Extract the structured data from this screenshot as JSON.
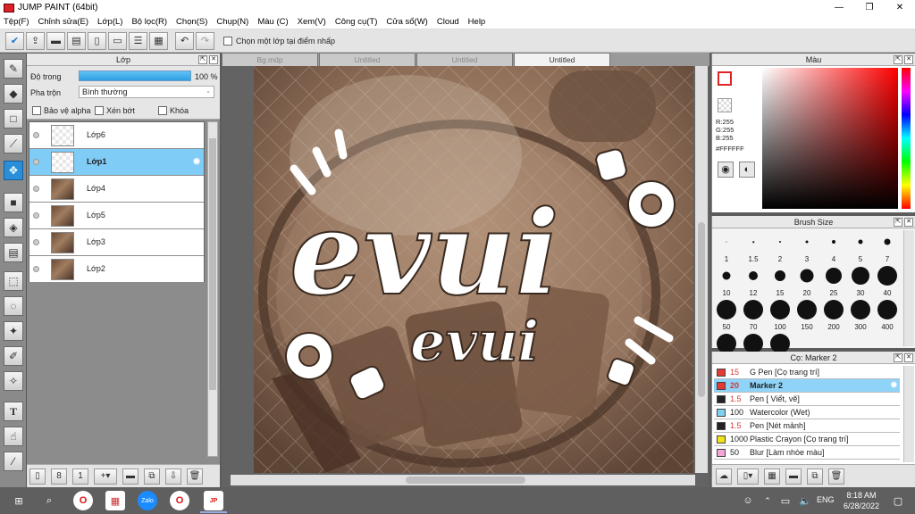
{
  "window": {
    "title": "JUMP PAINT (64bit)",
    "minimize": "—",
    "maximize": "❐",
    "close": "✕"
  },
  "menu": [
    "Tệp(F)",
    "Chỉnh sửa(E)",
    "Lớp(L)",
    "Bộ lọc(R)",
    "Chọn(S)",
    "Chụp(N)",
    "Màu (C)",
    "Xem(V)",
    "Công cụ(T)",
    "Cửa sổ(W)",
    "Cloud",
    "Help"
  ],
  "toolbar": {
    "snap_label": "Chọn một lớp tại điểm nhấp"
  },
  "layer_panel": {
    "title": "Lớp",
    "opacity_label": "Độ trong",
    "opacity_value": "100 %",
    "opacity_fraction": 1.0,
    "blend_label": "Pha trộn",
    "blend_value": "Bình thường",
    "protect_alpha": "Bảo vệ alpha",
    "clipping": "Xén bớt",
    "lock": "Khóa",
    "layers": [
      {
        "name": "Lớp6",
        "thumb": "empty",
        "selected": false
      },
      {
        "name": "Lớp1",
        "thumb": "empty",
        "selected": true
      },
      {
        "name": "Lớp4",
        "thumb": "photo",
        "selected": false
      },
      {
        "name": "Lớp5",
        "thumb": "photo",
        "selected": false
      },
      {
        "name": "Lớp3",
        "thumb": "photo",
        "selected": false
      },
      {
        "name": "Lớp2",
        "thumb": "photo",
        "selected": false
      }
    ]
  },
  "doc_tabs": [
    {
      "label": "Bg.mdp",
      "active": false
    },
    {
      "label": "Untitled",
      "active": false
    },
    {
      "label": "Untitled",
      "active": false
    },
    {
      "label": "Untitled",
      "active": true
    }
  ],
  "canvas": {
    "text_large": "evui",
    "text_small": "evui"
  },
  "color_panel": {
    "title": "Màu",
    "r": "R:255",
    "g": "G:255",
    "b": "B:255",
    "hex": "#FFFFFF"
  },
  "brush_panel": {
    "title": "Brush Size",
    "sizes": [
      "1",
      "1.5",
      "2",
      "3",
      "4",
      "5",
      "7",
      "10",
      "12",
      "15",
      "20",
      "25",
      "30",
      "40",
      "50",
      "70",
      "100",
      "150",
      "200",
      "300",
      "400"
    ]
  },
  "pen_panel": {
    "title": "Cọ: Marker 2",
    "items": [
      {
        "size": "15",
        "name": "G Pen [Cọ trang trí]",
        "color": "#e53935",
        "selected": false
      },
      {
        "size": "20",
        "name": "Marker 2",
        "color": "#e53935",
        "selected": true
      },
      {
        "size": "1.5",
        "name": "Pen [ Viết, vẽ]",
        "color": "#222222",
        "selected": false
      },
      {
        "size": "100",
        "name": "Watercolor (Wet)",
        "color": "#7fd3f0",
        "selected": false
      },
      {
        "size": "1.5",
        "name": "Pen [Nét mảnh]",
        "color": "#222222",
        "selected": false
      },
      {
        "size": "1000",
        "name": "Plastic Crayon [Cọ trang trí]",
        "color": "#f2e21a",
        "selected": false
      },
      {
        "size": "50",
        "name": "Blur [Làm nhòe màu]",
        "color": "#f5a5d8",
        "selected": false
      }
    ]
  },
  "taskbar": {
    "time": "8:18 AM",
    "date": "6/28/2022",
    "lang": "ENG"
  }
}
